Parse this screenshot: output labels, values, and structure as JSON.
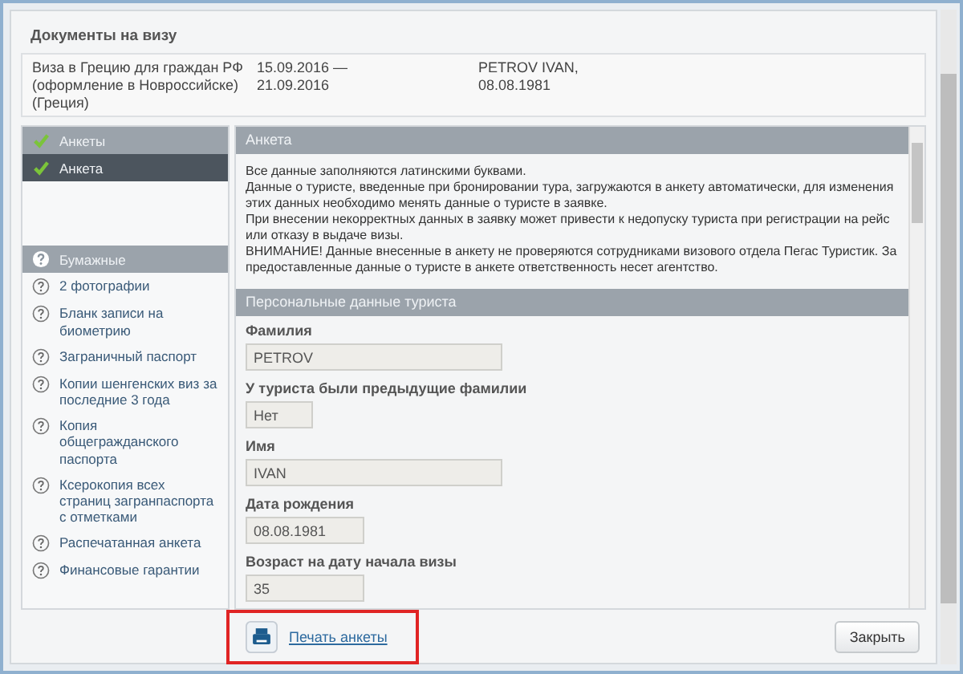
{
  "dialog": {
    "title": "Документы на визу"
  },
  "visa_info": {
    "name": "Виза в Грецию для граждан РФ (оформление в Новроссийске) (Греция)",
    "dates": "15.09.2016 —\n21.09.2016",
    "tourist": "PETROV IVAN,\n08.08.1981"
  },
  "sidebar": {
    "groups": [
      {
        "title": "Анкеты",
        "done": true,
        "items": [
          {
            "label": "Анкета",
            "done": true,
            "selected": true
          }
        ]
      },
      {
        "title": "Бумажные",
        "done": false,
        "items": [
          {
            "label": "2 фотографии",
            "done": false,
            "selected": false
          },
          {
            "label": "Бланк записи на биометрию",
            "done": false,
            "selected": false
          },
          {
            "label": "Заграничный паспорт",
            "done": false,
            "selected": false
          },
          {
            "label": "Копии шенгенских виз за последние 3 года",
            "done": false,
            "selected": false
          },
          {
            "label": "Копия общегражданского паспорта",
            "done": false,
            "selected": false
          },
          {
            "label": "Ксерокопия всех страниц загранпаспорта с отметками",
            "done": false,
            "selected": false
          },
          {
            "label": "Распечатанная анкета",
            "done": false,
            "selected": false
          },
          {
            "label": "Финансовые гарантии",
            "done": false,
            "selected": false
          }
        ]
      }
    ]
  },
  "form": {
    "title": "Анкета",
    "notes": [
      "Все данные заполняются латинскими буквами.",
      "Данные о туристе, введенные при бронировании тура, загружаются в анкету автоматически, для изменения этих данных необходимо менять данные о туристе в заявке.",
      "При внесении некорректных данных в заявку может привести к недопуску туриста при регистрации на рейс или отказу в выдаче визы.",
      "ВНИМАНИЕ! Данные внесенные в анкету не проверяются сотрудниками визового отдела Пегас Туристик. За предоставленные данные о туристе в анкете ответственность несет агентство."
    ],
    "section": "Персональные данные туриста",
    "fields": [
      {
        "label": "Фамилия",
        "value": "PETROV",
        "kind": "text"
      },
      {
        "label": "У туриста были предыдущие фамилии",
        "value": "Нет",
        "kind": "choice"
      },
      {
        "label": "Имя",
        "value": "IVAN",
        "kind": "text"
      },
      {
        "label": "Дата рождения",
        "value": "08.08.1981",
        "kind": "date"
      },
      {
        "label": "Возраст на дату начала визы",
        "value": "35",
        "kind": "date"
      }
    ]
  },
  "print_link": {
    "label": "Печать анкеты",
    "highlighted": true
  },
  "close_button": "Закрыть"
}
